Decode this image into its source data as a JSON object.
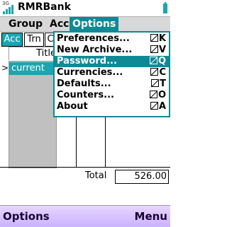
{
  "status": {
    "network": "3G",
    "app_title": "RMRBank"
  },
  "menubar": {
    "items": [
      "Group",
      "Acc",
      "Options"
    ],
    "active": "Options"
  },
  "tabs": [
    "Acc",
    "Trn",
    "C"
  ],
  "table": {
    "column_header": "Title",
    "row_marker": ">",
    "selected_cell": "current"
  },
  "dropdown": {
    "items": [
      {
        "label": "Preferences...",
        "accel": "K"
      },
      {
        "label": "New Archive...",
        "accel": "V"
      },
      {
        "label": "Password...",
        "accel": "Q",
        "selected": true
      },
      {
        "label": "Currencies...",
        "accel": "C"
      },
      {
        "label": "Defaults...",
        "accel": "T"
      },
      {
        "label": "Counters...",
        "accel": "O"
      },
      {
        "label": "About",
        "accel": "A"
      }
    ]
  },
  "total": {
    "label": "Total",
    "value": "526.00"
  },
  "softkeys": {
    "left": "Options",
    "right": "Menu"
  },
  "colors": {
    "accent": "#1aa5b1",
    "menu_highlight": "#0e8a96",
    "softkey_bg": "#cbb2ff"
  }
}
